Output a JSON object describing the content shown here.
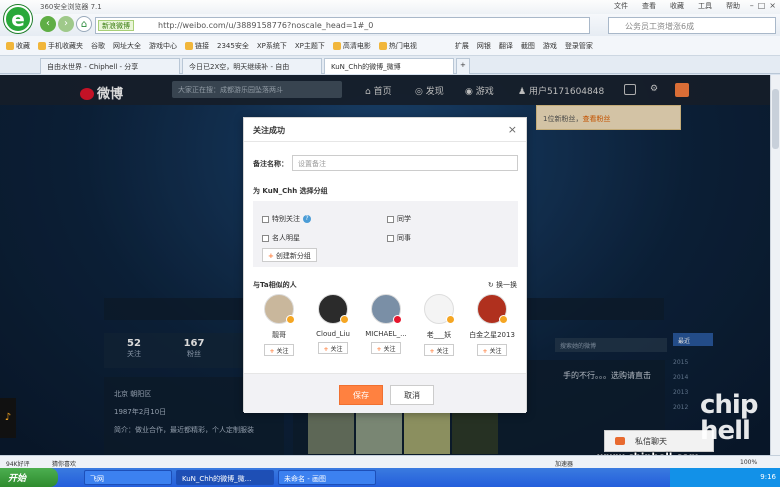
{
  "browser": {
    "app_title": "360安全浏览器 7.1",
    "menu": [
      "文件",
      "查看",
      "收藏",
      "工具",
      "帮助"
    ],
    "safe_label": "新浪微博",
    "url": "http://weibo.com/u/3889158776?noscale_head=1#_0",
    "search_placeholder": "公务员工资增涨6成",
    "favorites": [
      "收藏",
      "手机收藏夹",
      "谷歌",
      "网址大全",
      "游戏中心",
      "链接",
      "2345安全",
      "XP系统下",
      "XP主题下",
      "高清电影",
      "热门电视",
      "扩展",
      "网银",
      "翻译",
      "截图",
      "游戏",
      "登录管家"
    ],
    "tabs": [
      {
        "label": "自由水世界 - Chiphell - 分享"
      },
      {
        "label": "今日已2X空，明天继续补 - 自由"
      },
      {
        "label": "KuN_Chh的微博_微博"
      }
    ]
  },
  "weibo": {
    "logo_text": "微博",
    "search_placeholder": "大家正在搜：成都游乐园坠落两斗",
    "nav": {
      "home": "首页",
      "discover": "发现",
      "game": "游戏",
      "user": "用户5171604848"
    },
    "tip": {
      "text": "1位新粉丝，",
      "link": "查看粉丝"
    },
    "stats": [
      {
        "value": "52",
        "label": "关注"
      },
      {
        "value": "167",
        "label": "粉丝"
      }
    ],
    "side_search": "搜索她的微博",
    "recent": "最近",
    "info": {
      "location": "北京 朝阳区",
      "birthday": "1987年2月10日",
      "intro": "简介：做业合作，最近都精彩，个人定制服装"
    },
    "feed_text": "手的不行。。。选购请直击",
    "years": [
      "2015",
      "2014",
      "2013",
      "2012"
    ],
    "chat_label": "私信聊天"
  },
  "modal": {
    "title": "关注成功",
    "close": "×",
    "remark_label": "备注名称：",
    "remark_placeholder": "设置备注",
    "group_title": "为 KuN_Chh 选择分组",
    "groups": [
      "特别关注",
      "同学",
      "名人明星",
      "同事"
    ],
    "help": "?",
    "new_group": "创建新分组",
    "related_title": "与Ta相似的人",
    "refresh": "换一换",
    "people": [
      {
        "name": "靓哥",
        "follow": "关注"
      },
      {
        "name": "Cloud_Liu",
        "follow": "关注"
      },
      {
        "name": "MICHAEL_...",
        "follow": "关注"
      },
      {
        "name": "老___妖",
        "follow": "关注"
      },
      {
        "name": "白金之星2013",
        "follow": "关注"
      }
    ],
    "save": "保存",
    "cancel": "取消"
  },
  "status": {
    "left1": "94K好评",
    "left2": "猜你喜欢",
    "right": "加速器",
    "zoom": "100%"
  },
  "taskbar": {
    "start": "开始",
    "tasks": [
      "飞网",
      "KuN_Chh的微博_微...",
      "未命名 - 画图"
    ],
    "time": "9:16"
  },
  "watermark": {
    "brand": "chip hell",
    "url": "www.chiphell.com"
  }
}
